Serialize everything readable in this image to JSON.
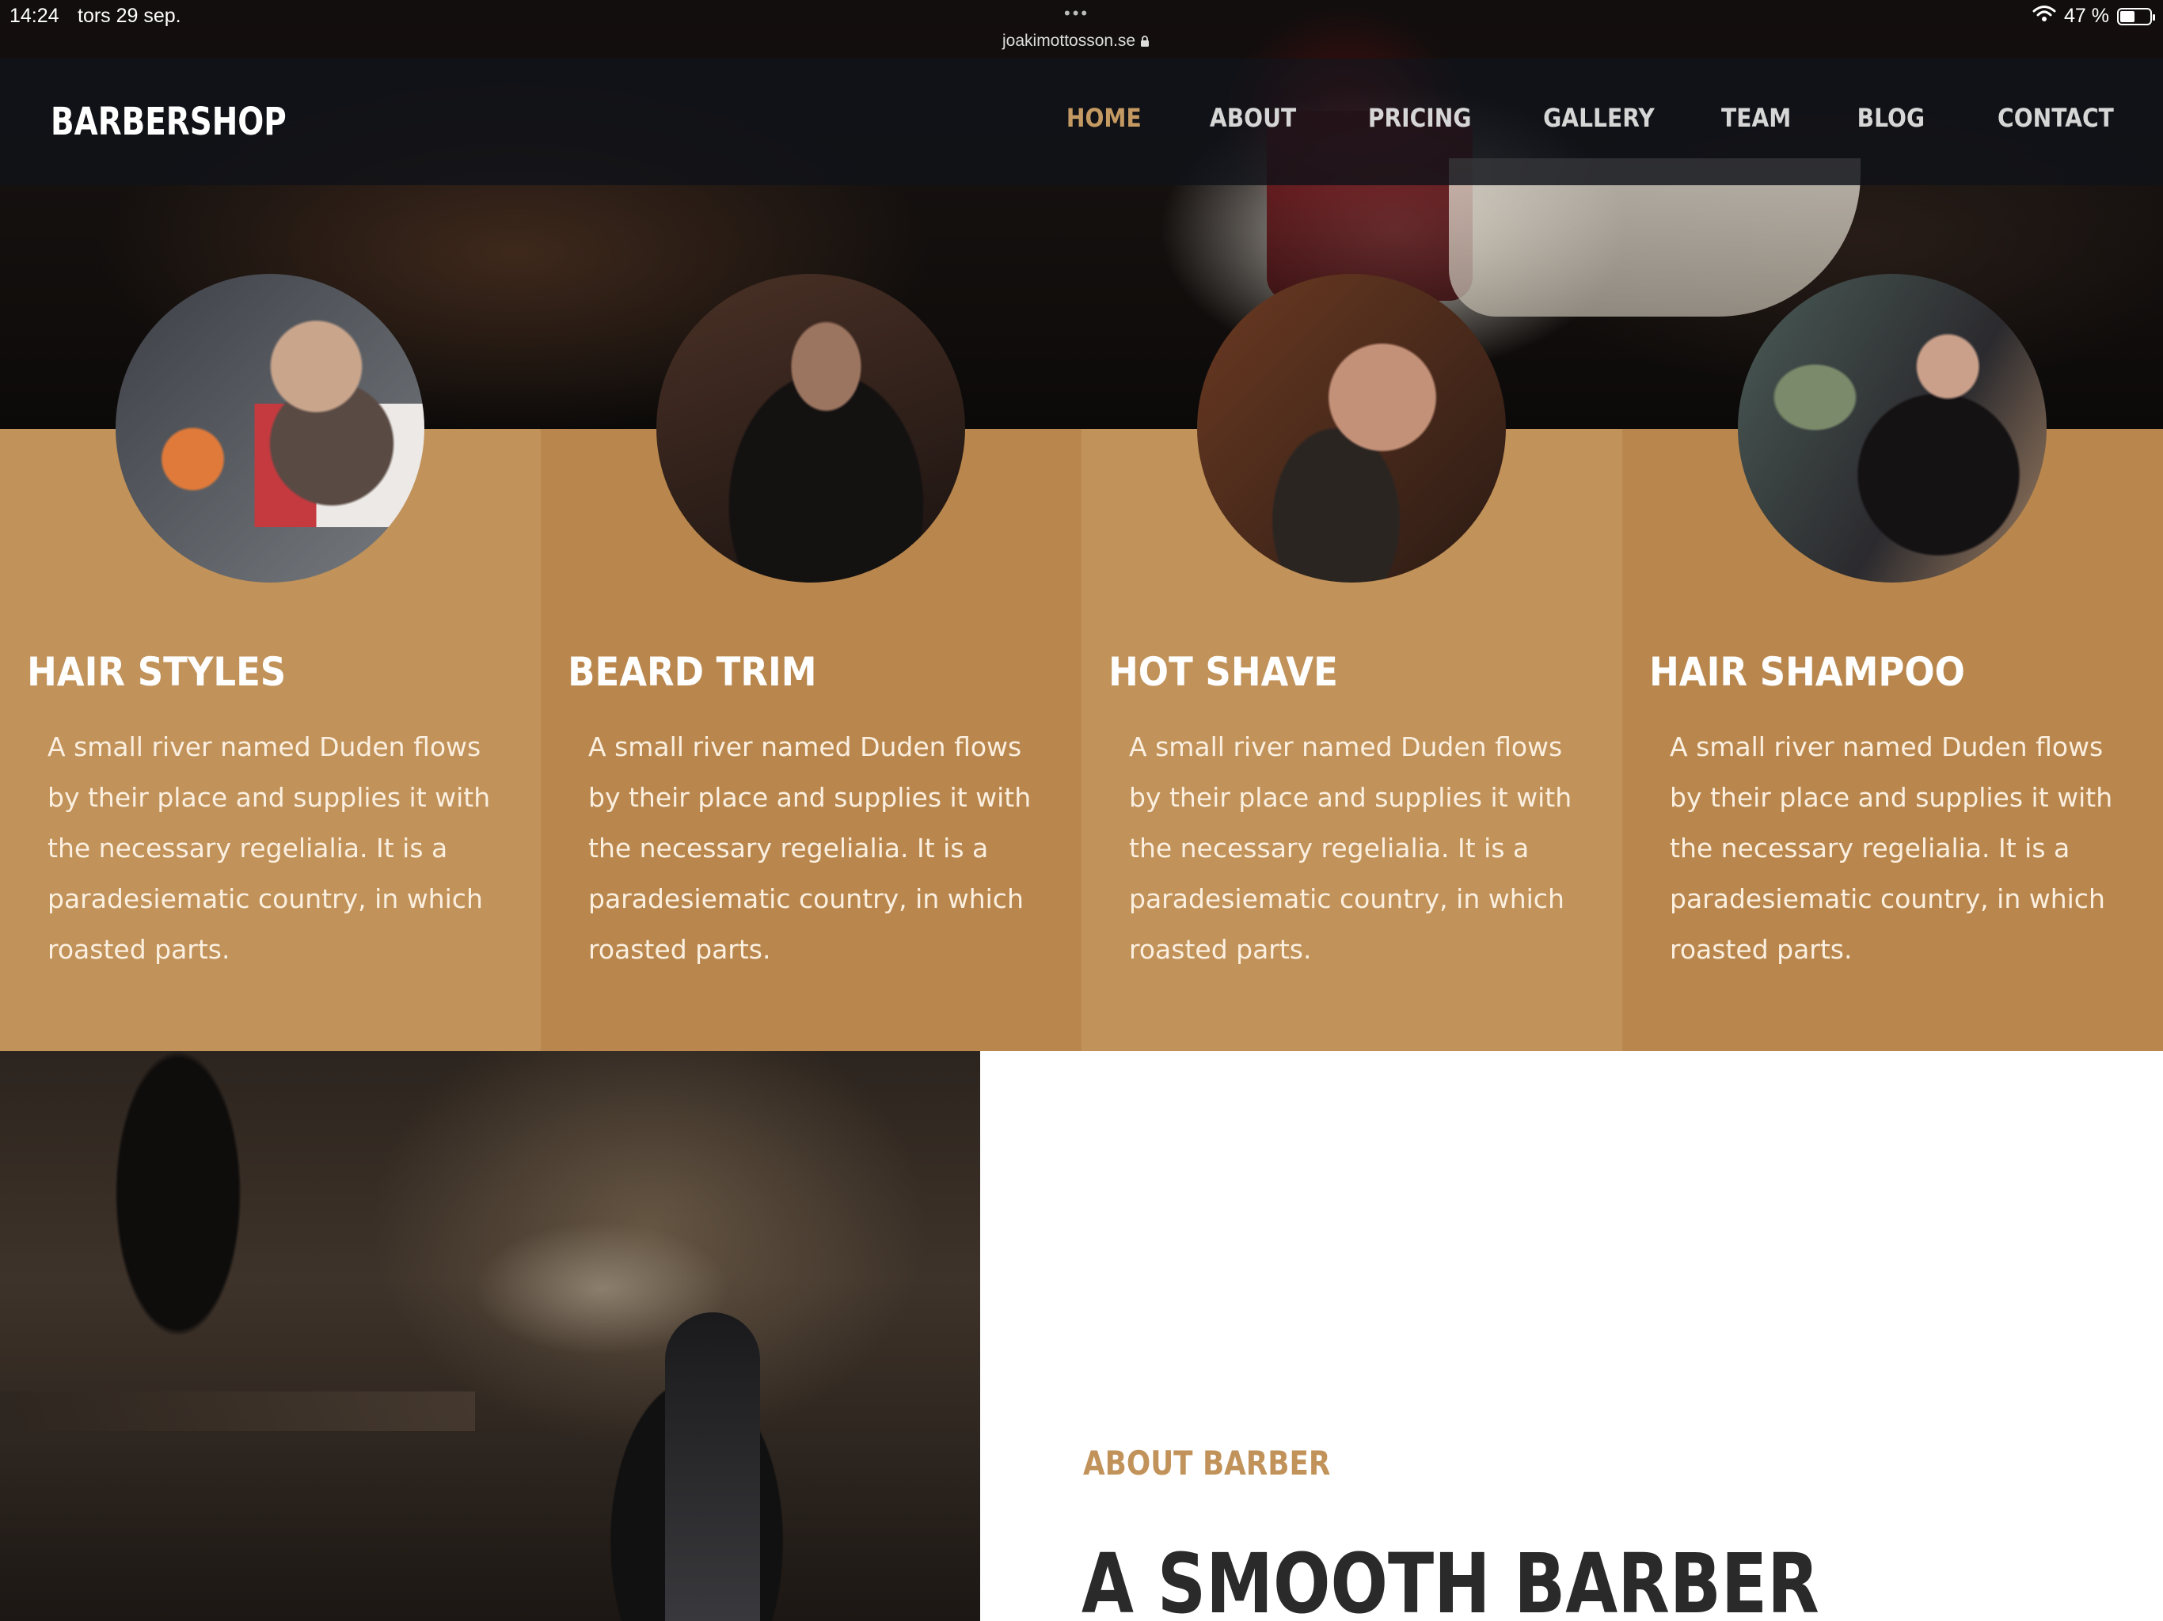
{
  "status_bar": {
    "time": "14:24",
    "date": "tors 29 sep.",
    "url": "joakimottosson.se",
    "battery": "47 %"
  },
  "site": {
    "brand": "BARBERSHOP",
    "nav": [
      "HOME",
      "ABOUT",
      "PRICING",
      "GALLERY",
      "TEAM",
      "BLOG",
      "CONTACT"
    ],
    "active_nav": "HOME"
  },
  "services": [
    {
      "title": "HAIR STYLES",
      "text": "A small river named Duden flows by their place and supplies it with the necessary regelialia. It is a paradesiematic country, in which roasted parts."
    },
    {
      "title": "BEARD TRIM",
      "text": "A small river named Duden flows by their place and supplies it with the necessary regelialia. It is a paradesiematic country, in which roasted parts."
    },
    {
      "title": "HOT SHAVE",
      "text": "A small river named Duden flows by their place and supplies it with the necessary regelialia. It is a paradesiematic country, in which roasted parts."
    },
    {
      "title": "HAIR SHAMPOO",
      "text": "A small river named Duden flows by their place and supplies it with the necessary regelialia. It is a paradesiematic country, in which roasted parts."
    }
  ],
  "about": {
    "eyebrow": "ABOUT BARBER",
    "title": "A SMOOTH BARBER"
  },
  "colors": {
    "accent": "#c19259",
    "accent_dark": "#b9874d",
    "nav_bg": "#101218",
    "text_dark": "#2a2a2a"
  }
}
